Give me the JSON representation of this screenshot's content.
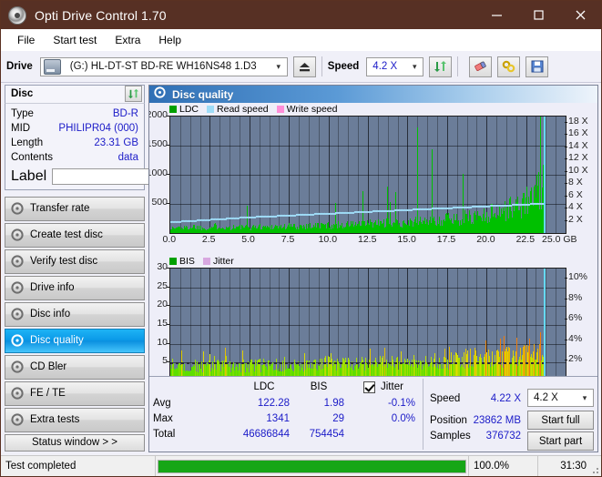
{
  "window": {
    "title": "Opti Drive Control 1.70",
    "app_icon": "disc-icon",
    "minimize": "−",
    "maximize": "□",
    "close": "✕"
  },
  "menu": [
    "File",
    "Start test",
    "Extra",
    "Help"
  ],
  "toolbar": {
    "drive_label": "Drive",
    "drive_value": "(G:)  HL-DT-ST BD-RE  WH16NS48 1.D3",
    "eject_icon": "eject-icon",
    "speed_label": "Speed",
    "speed_value": "4.2 X",
    "refresh_icon": "refresh-icon",
    "erase_icon": "eraser-icon",
    "tools_icon": "tools-icon",
    "save_icon": "save-icon"
  },
  "disc_panel": {
    "title": "Disc",
    "refresh_icon": "refresh-icon",
    "rows": [
      {
        "key": "Type",
        "value": "BD-R"
      },
      {
        "key": "MID",
        "value": "PHILIPR04 (000)"
      },
      {
        "key": "Length",
        "value": "23.31 GB"
      },
      {
        "key": "Contents",
        "value": "data"
      }
    ],
    "label_key": "Label",
    "label_value": "",
    "label_placeholder": "",
    "label_button_icon": "cd-icon"
  },
  "nav": {
    "items": [
      {
        "label": "Transfer rate",
        "active": false
      },
      {
        "label": "Create test disc",
        "active": false
      },
      {
        "label": "Verify test disc",
        "active": false
      },
      {
        "label": "Drive info",
        "active": false
      },
      {
        "label": "Disc info",
        "active": false
      },
      {
        "label": "Disc quality",
        "active": true
      },
      {
        "label": "CD Bler",
        "active": false
      },
      {
        "label": "FE / TE",
        "active": false
      },
      {
        "label": "Extra tests",
        "active": false
      }
    ],
    "status_window": "Status window > >"
  },
  "content": {
    "header_title": "Disc quality",
    "header_icon": "disc-icon"
  },
  "chart_data": [
    {
      "type": "bar",
      "title": "LDC / Read speed",
      "xlabel": "GB",
      "ylabel": "LDC",
      "xlim": [
        0.0,
        25.0
      ],
      "ylim": [
        0,
        2000
      ],
      "grid": true,
      "legend_position": "top-left",
      "legend": [
        {
          "name": "LDC",
          "color": "#00a000"
        },
        {
          "name": "Read speed",
          "color": "#9fdcf7"
        },
        {
          "name": "Write speed",
          "color": "#ff8fd8"
        }
      ],
      "xticks": [
        "0.0",
        "2.5",
        "5.0",
        "7.5",
        "10.0",
        "12.5",
        "15.0",
        "17.5",
        "20.0",
        "22.5",
        "25.0 GB"
      ],
      "yticks_left": [
        "2000",
        "1500",
        "1000",
        "500"
      ],
      "yticks_right": [
        "18 X",
        "16 X",
        "14 X",
        "12 X",
        "10 X",
        "8 X",
        "6 X",
        "4 X",
        "2 X"
      ],
      "y2lim": [
        0,
        19
      ],
      "series": [
        {
          "name": "LDC",
          "color": "#00c000",
          "x": [
            0.0,
            0.5,
            1.0,
            1.5,
            2.0,
            2.5,
            3.0,
            3.5,
            4.0,
            4.5,
            5.0,
            5.5,
            6.0,
            6.5,
            7.0,
            7.5,
            8.0,
            8.5,
            9.0,
            9.5,
            10.0,
            10.5,
            11.0,
            11.5,
            12.0,
            12.5,
            13.0,
            13.5,
            14.0,
            14.5,
            15.0,
            15.5,
            16.0,
            16.5,
            17.0,
            17.5,
            18.0,
            18.5,
            19.0,
            19.5,
            20.0,
            20.5,
            21.0,
            21.5,
            22.0,
            22.5,
            23.0,
            23.5
          ],
          "values": [
            90,
            110,
            100,
            130,
            95,
            105,
            140,
            100,
            115,
            120,
            110,
            125,
            115,
            130,
            120,
            135,
            125,
            140,
            135,
            150,
            145,
            160,
            155,
            170,
            165,
            185,
            175,
            200,
            195,
            215,
            210,
            230,
            225,
            250,
            245,
            275,
            270,
            300,
            310,
            340,
            360,
            400,
            430,
            480,
            520,
            600,
            700,
            900
          ]
        },
        {
          "name": "Read speed",
          "color": "#9fdcf7",
          "x": [
            0.0,
            2.5,
            5.0,
            7.5,
            10.0,
            12.5,
            15.0,
            17.5,
            20.0,
            22.5,
            23.5
          ],
          "values": [
            1.9,
            2.3,
            2.7,
            3.0,
            3.3,
            3.6,
            3.9,
            4.2,
            4.5,
            4.8,
            4.9
          ]
        }
      ]
    },
    {
      "type": "bar",
      "title": "BIS / Jitter",
      "xlabel": "GB",
      "ylabel": "BIS",
      "xlim": [
        0.0,
        25.0
      ],
      "ylim": [
        0,
        30
      ],
      "grid": true,
      "legend_position": "top-left",
      "legend": [
        {
          "name": "BIS",
          "color": "#00a000"
        },
        {
          "name": "Jitter",
          "color": "#d8a8e0"
        }
      ],
      "xticks": [
        "0.0",
        "2.5",
        "5.0",
        "7.5",
        "10.0",
        "12.5",
        "15.0",
        "17.5",
        "20.0",
        "22.5",
        "25.0 GB"
      ],
      "yticks_left": [
        "30",
        "25",
        "20",
        "15",
        "10",
        "5"
      ],
      "yticks_right": [
        "10%",
        "8%",
        "6%",
        "4%",
        "2%"
      ],
      "y2lim": [
        0,
        11
      ],
      "series": [
        {
          "name": "BIS",
          "color": "#5ede00",
          "x": [
            0.0,
            1.0,
            2.0,
            3.0,
            4.0,
            5.0,
            6.0,
            7.0,
            8.0,
            9.0,
            10.0,
            11.0,
            12.0,
            13.0,
            14.0,
            15.0,
            16.0,
            17.0,
            18.0,
            19.0,
            20.0,
            21.0,
            22.0,
            23.0,
            23.5
          ],
          "values": [
            5.0,
            4.8,
            5.0,
            5.2,
            5.0,
            5.3,
            5.4,
            5.5,
            5.6,
            5.8,
            5.9,
            6.0,
            6.1,
            6.2,
            6.3,
            6.5,
            6.7,
            6.9,
            7.1,
            7.4,
            7.8,
            8.2,
            8.6,
            9.2,
            9.8
          ]
        },
        {
          "name": "Jitter",
          "color": "#c9a4dd",
          "x": [
            0.0,
            5.0,
            10.0,
            15.0,
            20.0,
            23.5
          ],
          "values": [
            5.0,
            5.0,
            5.0,
            5.0,
            5.0,
            5.0
          ]
        }
      ]
    }
  ],
  "stats": {
    "columns": [
      "LDC",
      "BIS"
    ],
    "jitter_label": "Jitter",
    "jitter_checked": true,
    "rows": [
      {
        "label": "Avg",
        "ldc": "122.28",
        "bis": "1.98",
        "jitter": "-0.1%"
      },
      {
        "label": "Max",
        "ldc": "1341",
        "bis": "29",
        "jitter": "0.0%"
      },
      {
        "label": "Total",
        "ldc": "46686844",
        "bis": "754454",
        "jitter": ""
      }
    ],
    "speed_label": "Speed",
    "speed_value": "4.22 X",
    "position_label": "Position",
    "position_value": "23862 MB",
    "samples_label": "Samples",
    "samples_value": "376732",
    "speed_select": "4.2 X",
    "start_full": "Start full",
    "start_part": "Start part"
  },
  "statusbar": {
    "message": "Test completed",
    "percent_text": "100.0%",
    "percent_value": 100,
    "elapsed": "31:30"
  },
  "colors": {
    "titlebar": "#573024",
    "accent_blue": "#1b1bc8",
    "active_nav": "#0b9ae8",
    "plot_bg": "#6b7d99",
    "ldc_green": "#00c000",
    "progress_green": "#16a616"
  }
}
